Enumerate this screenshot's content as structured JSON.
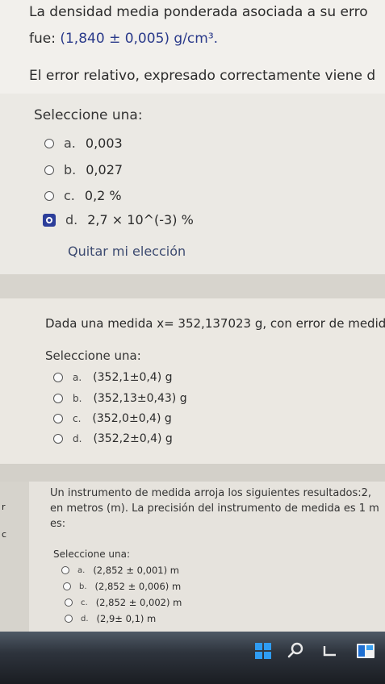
{
  "question1": {
    "line1": "La densidad media ponderada asociada a su erro",
    "line2_prefix": "fue: ",
    "line2_value": "(1,840 ± 0,005) g/cm³.",
    "line3": "El error relativo, expresado correctamente viene d",
    "select_label": "Seleccione una:",
    "options": [
      {
        "letter": "a.",
        "text": "0,003",
        "selected": false
      },
      {
        "letter": "b.",
        "text": "0,027",
        "selected": false
      },
      {
        "letter": "c.",
        "text": "0,2 %",
        "selected": false
      },
      {
        "letter": "d.",
        "text": "2,7 × 10^(-3) %",
        "selected": true
      }
    ],
    "clear_choice": "Quitar mi elección"
  },
  "question2": {
    "prompt": "Dada una medida x= 352,137023 g, con error de medida",
    "select_label": "Seleccione una:",
    "options": [
      {
        "letter": "a.",
        "text": "(352,1±0,4) g"
      },
      {
        "letter": "b.",
        "text": "(352,13±0,43) g"
      },
      {
        "letter": "c.",
        "text": "(352,0±0,4) g"
      },
      {
        "letter": "d.",
        "text": "(352,2±0,4) g"
      }
    ]
  },
  "question3": {
    "line1": "Un instrumento de medida arroja los siguientes resultados:2,",
    "line2": "en metros (m). La precisión del instrumento de medida es 1 m",
    "line3": "es:",
    "select_label": "Seleccione una:",
    "options": [
      {
        "letter": "a.",
        "text": "(2,852 ± 0,001) m"
      },
      {
        "letter": "b.",
        "text": "(2,852 ± 0,006) m"
      },
      {
        "letter": "c.",
        "text": "(2,852 ± 0,002) m"
      },
      {
        "letter": "d.",
        "text": "(2,9± 0,1) m"
      }
    ]
  },
  "side_marks": [
    "r",
    "c"
  ],
  "taskbar": {
    "icons": [
      "windows-start-icon",
      "search-icon",
      "task-view-icon",
      "widgets-icon"
    ],
    "accent": "#2f9cf2"
  }
}
